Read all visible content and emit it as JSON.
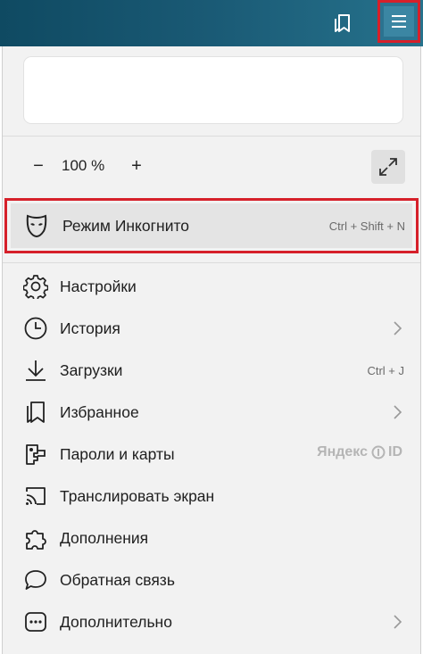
{
  "toolbar": {
    "bookmark_icon": "bookmark-icon",
    "menu_icon": "hamburger-icon",
    "colors": {
      "bar_start": "#0f4a62",
      "bar_end": "#26728c",
      "highlight_border": "#d6202a"
    }
  },
  "zoom": {
    "minus": "−",
    "value": "100 %",
    "plus": "+",
    "fullscreen_icon": "fullscreen-icon"
  },
  "incognito": {
    "label": "Режим Инкогнито",
    "shortcut": "Ctrl + Shift + N",
    "icon": "mask-icon"
  },
  "items": [
    {
      "label": "Настройки",
      "icon": "gear-icon"
    },
    {
      "label": "История",
      "icon": "clock-icon",
      "submenu": true
    },
    {
      "label": "Загрузки",
      "icon": "download-icon",
      "shortcut": "Ctrl + J"
    },
    {
      "label": "Избранное",
      "icon": "bookmarks-icon",
      "submenu": true
    },
    {
      "label": "Пароли и карты",
      "icon": "key-icon",
      "badge_brand": "Яндекс",
      "badge_id": "ID"
    },
    {
      "label": "Транслировать экран",
      "icon": "cast-icon"
    },
    {
      "label": "Дополнения",
      "icon": "puzzle-icon"
    },
    {
      "label": "Обратная связь",
      "icon": "speech-bubble-icon"
    },
    {
      "label": "Дополнительно",
      "icon": "more-icon",
      "submenu": true
    }
  ]
}
